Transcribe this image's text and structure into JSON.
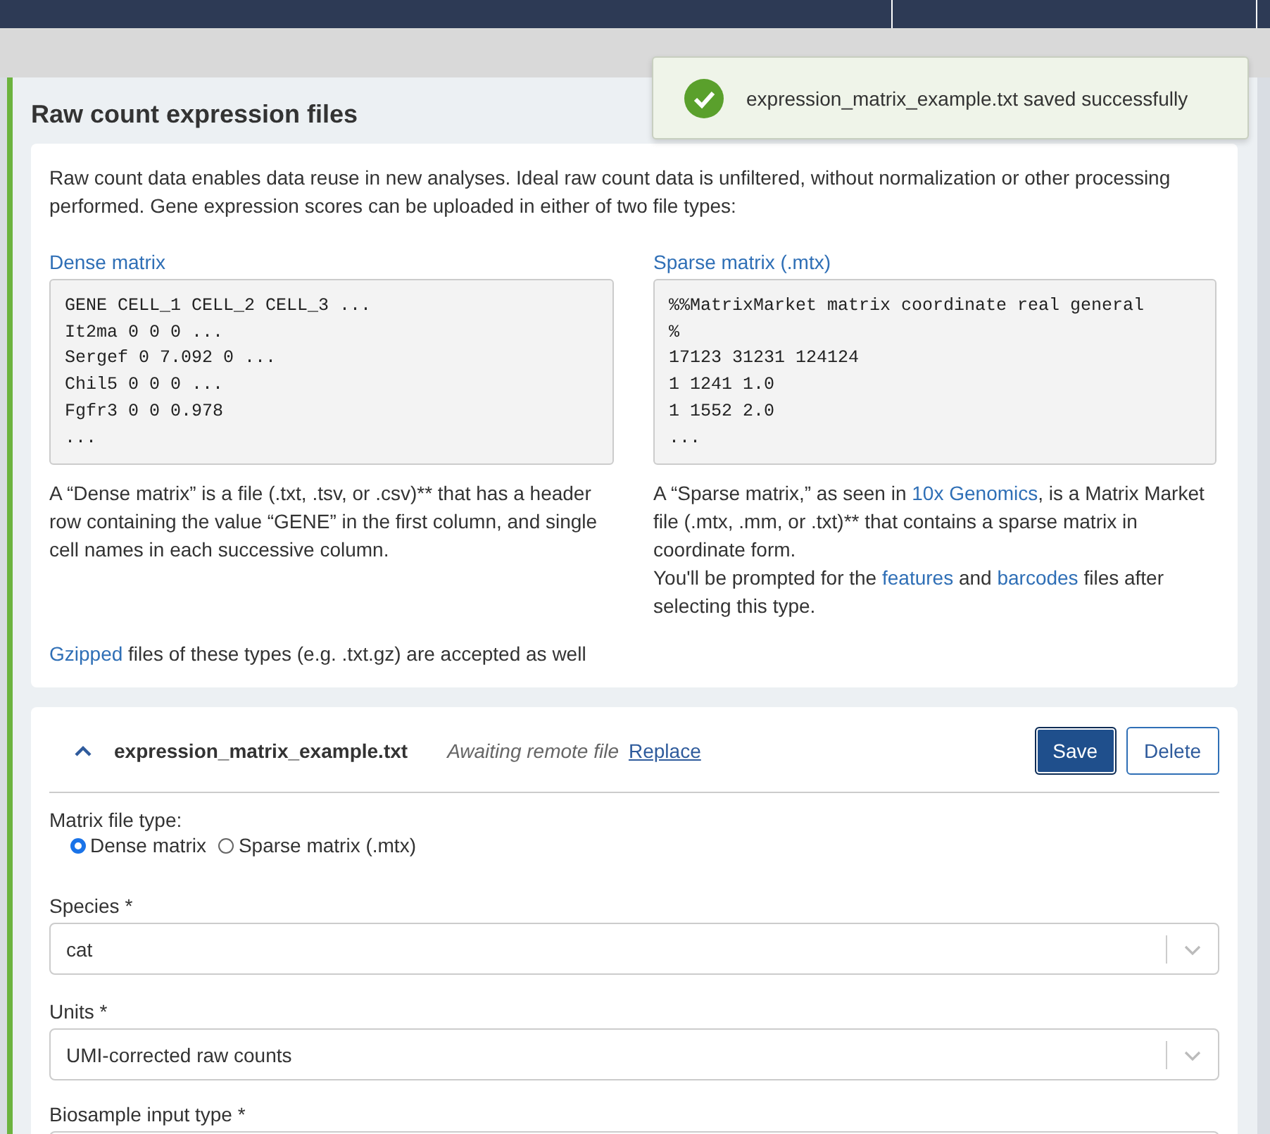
{
  "toast": {
    "message": "expression_matrix_example.txt saved successfully"
  },
  "section": {
    "title": "Raw count expression files",
    "intro": "Raw count data enables data reuse in new analyses. Ideal raw count data is unfiltered, without normalization or other processing performed. Gene expression scores can be uploaded in either of two file types:",
    "formats": [
      {
        "title": "Dense matrix",
        "code": [
          "GENE CELL_1 CELL_2 CELL_3 ...",
          "It2ma 0 0 0 ...",
          "Sergef 0 7.092 0 ...",
          "Chil5 0 0 0 ...",
          "Fgfr3 0 0 0.978",
          "..."
        ],
        "paragraphs": [
          [
            {
              "text": "A “Dense matrix” is a file (.txt, .tsv, or .csv)** that has a header row containing the value “GENE” in the first column, and single cell names in each successive column.",
              "link": false
            }
          ]
        ]
      },
      {
        "title": "Sparse matrix (.mtx)",
        "code": [
          "%%MatrixMarket matrix coordinate real general",
          "%",
          "17123 31231 124124",
          "1 1241 1.0",
          "1 1552 2.0",
          "..."
        ],
        "paragraphs": [
          [
            {
              "text": "A “Sparse matrix,” as seen in ",
              "link": false
            },
            {
              "text": "10x Genomics",
              "link": true
            },
            {
              "text": ", is a Matrix Market file (.mtx, .mm, or .txt)** that contains a sparse matrix in coordinate form.",
              "link": false
            }
          ],
          [
            {
              "text": "You'll be prompted for the ",
              "link": false
            },
            {
              "text": "features",
              "link": true
            },
            {
              "text": " and ",
              "link": false
            },
            {
              "text": "barcodes",
              "link": true
            },
            {
              "text": " files after selecting this type.",
              "link": false
            }
          ]
        ]
      }
    ],
    "note": [
      {
        "text": "Gzipped",
        "link": true
      },
      {
        "text": " files of these types (e.g. .txt.gz) are accepted as well",
        "link": false
      }
    ]
  },
  "file_card": {
    "expanded": true,
    "filename": "expression_matrix_example.txt",
    "status": "Awaiting remote file",
    "replace_link": "Replace",
    "buttons": [
      {
        "label": "Save",
        "kind": "primary"
      },
      {
        "label": "Delete",
        "kind": "secondary"
      }
    ],
    "matrix_type": {
      "label": "Matrix file type:",
      "options": [
        {
          "label": "Dense matrix",
          "selected": true
        },
        {
          "label": "Sparse matrix (.mtx)",
          "selected": false
        }
      ]
    },
    "fields": [
      {
        "label": "Species *",
        "value": "cat"
      },
      {
        "label": "Units *",
        "value": "UMI-corrected raw counts"
      },
      {
        "label": "Biosample input type *"
      }
    ]
  }
}
